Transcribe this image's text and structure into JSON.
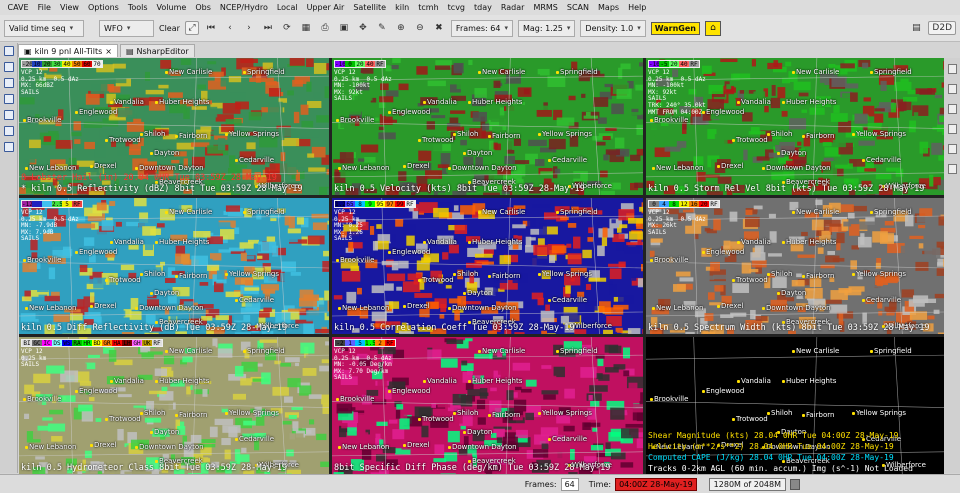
{
  "menu": [
    "CAVE",
    "File",
    "View",
    "Options",
    "Tools",
    "Volume",
    "Obs",
    "NCEP/Hydro",
    "Local",
    "Upper Air",
    "Satellite",
    "kiln",
    "tcmh",
    "tcvg",
    "tday",
    "Radar",
    "MRMS",
    "SCAN",
    "Maps",
    "Help"
  ],
  "toolbar": {
    "time_mode": "Valid time seq",
    "wfo": "WFO",
    "clear": "Clear",
    "frames_label": "Frames: 64",
    "mag_label": "Mag: 1.25",
    "density_label": "Density: 1.0",
    "warngen": "WarnGen",
    "d2d": "D2D"
  },
  "tabs": [
    {
      "label": "kiln 9 pnl All-Tilts",
      "close": "×"
    },
    {
      "label": "NsharpEditor",
      "close": ""
    }
  ],
  "towns": [
    "New Carlisle",
    "Springfield",
    "Vandalia",
    "Huber Heights",
    "Englewood",
    "Brookville",
    "Yellow Springs",
    "Trotwood",
    "Shiloh",
    "Dayton",
    "Fairborn",
    "Drexel",
    "Downtown Dayton",
    "Cedarville",
    "New Lebanon",
    "Beavercreek",
    "Wilberforce",
    "Xenia",
    "Phillipsburg",
    "Park Layne",
    "Enon"
  ],
  "panels": [
    {
      "colorbar": [
        "-20",
        "10",
        "20",
        "30",
        "40",
        "50",
        "60",
        "70"
      ],
      "info": "VCP 12\n0.25 km  0.5 dAz\nMX: 66dBZ\nSAILS",
      "caption": "* kiln 0.5  Reflectivity (dBZ) 8bit  Tue 03:59Z 28-May-19",
      "alert": "8 Lobster Hail (in)  20.04  0HR Tue 03:59Z 28-May-19"
    },
    {
      "colorbar": [
        "-100",
        "0",
        "20",
        "40",
        "RF"
      ],
      "info": "VCP 12\n0.25 km  0.5 dAz\nMN: -100kt\nMX: 92kt\nSAILS",
      "caption": "kiln 0.5  Velocity (kts) 8bit  Tue 03:59Z 28-May-19"
    },
    {
      "colorbar": [
        "-100",
        "-5",
        "20",
        "40",
        "RF"
      ],
      "info": "VCP 12\n0.25 km  0.5 dAz\nMN: -100kt\nMX: 92kt\nSAILS\nTRK: 240° 35.0kt\nMMT FROM 04:00Z",
      "caption": "kiln 0.5  Storm Rel Vel 8bit (kts)  Tue 03:59Z 28-May-19"
    },
    {
      "colorbar": [
        "-12",
        "",
        "",
        "2.5",
        "5",
        "RF"
      ],
      "info": "VCP 12\n0.25 km  0.5 dAz\nMN: -7.9dB\nMX: 7.9dB\nSAILS",
      "caption": "kiln 0.5  Diff Reflectivity (dB)  Tue 03:59Z 28-May-19"
    },
    {
      "colorbar": [
        "1.2",
        "65",
        "8",
        "9",
        "95",
        "97",
        "99",
        "RF"
      ],
      "info": "VCP 12\n0.25 km\nMN: 0.25\nMX: 1.26\nSAILS",
      "caption": "kiln 0.5  Correlation Coeff  Tue 03:59Z 28-May-19"
    },
    {
      "colorbar": [
        "0",
        "4",
        "8",
        "12",
        "16",
        "20",
        "RF"
      ],
      "info": "VCP 12\n0.25 km  0.5 dAz\nMX: 26kt\nSAILS",
      "caption": "kiln 0.5  Spectrum Width (kts) 8bit  Tue 03:59Z 28-May-19"
    },
    {
      "colorbar": [
        "BI",
        "GC",
        "IC",
        "DS",
        "WS",
        "RA",
        "HR",
        "BD",
        "GR",
        "HA",
        "LH",
        "GH",
        "UK",
        "RF"
      ],
      "info": "VCP 12\n0.25 km\nSAILS",
      "caption": "kiln 0.5  Hydrometeor Class 8bit  Tue 03:59Z 28-May-19"
    },
    {
      "colorbar": [
        "-2",
        "1",
        "5",
        "1.5",
        "2",
        "RF"
      ],
      "info": "VCP 12\n0.25 km  0.5 dAz\nMN: -0.05 Deg/km\nMX: 7.70 Deg/km\nSAILS",
      "caption": "8bit Specific Diff Phase (deg/km)  Tue 03:59Z 28-May-19"
    },
    {
      "lines": [
        {
          "text": "Shear Magnitude  (kts)          28.04   0HR Tue 04:00Z 28-May-19",
          "color": "#ffe000"
        },
        {
          "text": "Helicity (m**2/s**2)            28.04   0HR Tue 04:00Z 28-May-19",
          "color": "#ffe000"
        },
        {
          "text": "Computed CAPE  (J/kg)            28.04   0HR Tue 04:00Z 28-May-19",
          "color": "#00e0ff"
        },
        {
          "text": "Tracks 0-2km AGL (60 min. accum.) Img (s^-1)    Not Loaded",
          "color": "#ffffff"
        }
      ]
    }
  ],
  "status": {
    "frames_label": "Frames:",
    "frames_value": "64",
    "time_label": "Time:",
    "time_value": "04:00Z 28-May-19",
    "memory": "1280M of 2048M"
  }
}
